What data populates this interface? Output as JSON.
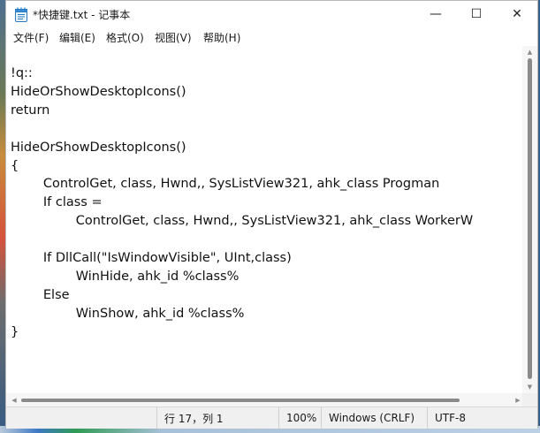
{
  "window": {
    "title": "*快捷键.txt - 记事本",
    "controls": {
      "minimize_icon": "—",
      "maximize_icon": "☐",
      "close_icon": "✕"
    }
  },
  "menu": [
    {
      "label": "文件(F)"
    },
    {
      "label": "编辑(E)"
    },
    {
      "label": "格式(O)"
    },
    {
      "label": "视图(V)"
    },
    {
      "label": "帮助(H)"
    }
  ],
  "editor": {
    "content": "!q::\nHideOrShowDesktopIcons()\nreturn\n\nHideOrShowDesktopIcons()\n{\n\tControlGet, class, Hwnd,, SysListView321, ahk_class Progman\n\tIf class =\n\t\tControlGet, class, Hwnd,, SysListView321, ahk_class WorkerW\n\n\tIf DllCall(\"IsWindowVisible\", UInt,class)\n\t\tWinHide, ahk_id %class%\n\tElse\n\t\tWinShow, ahk_id %class%\n}"
  },
  "status": {
    "position": "行 17，列 1",
    "zoom": "100%",
    "line_ending": "Windows (CRLF)",
    "encoding": "UTF-8"
  },
  "colors": {
    "window_bg": "#ffffff",
    "statusbar_bg": "#f0f0f0",
    "text": "#111111",
    "scroll_thumb": "#8a8a8a"
  },
  "icons": {
    "app": "notepad-icon",
    "scroll_up": "scroll-up-arrow-icon",
    "scroll_down": "scroll-down-arrow-icon",
    "scroll_left": "scroll-left-arrow-icon",
    "scroll_right": "scroll-right-arrow-icon"
  }
}
